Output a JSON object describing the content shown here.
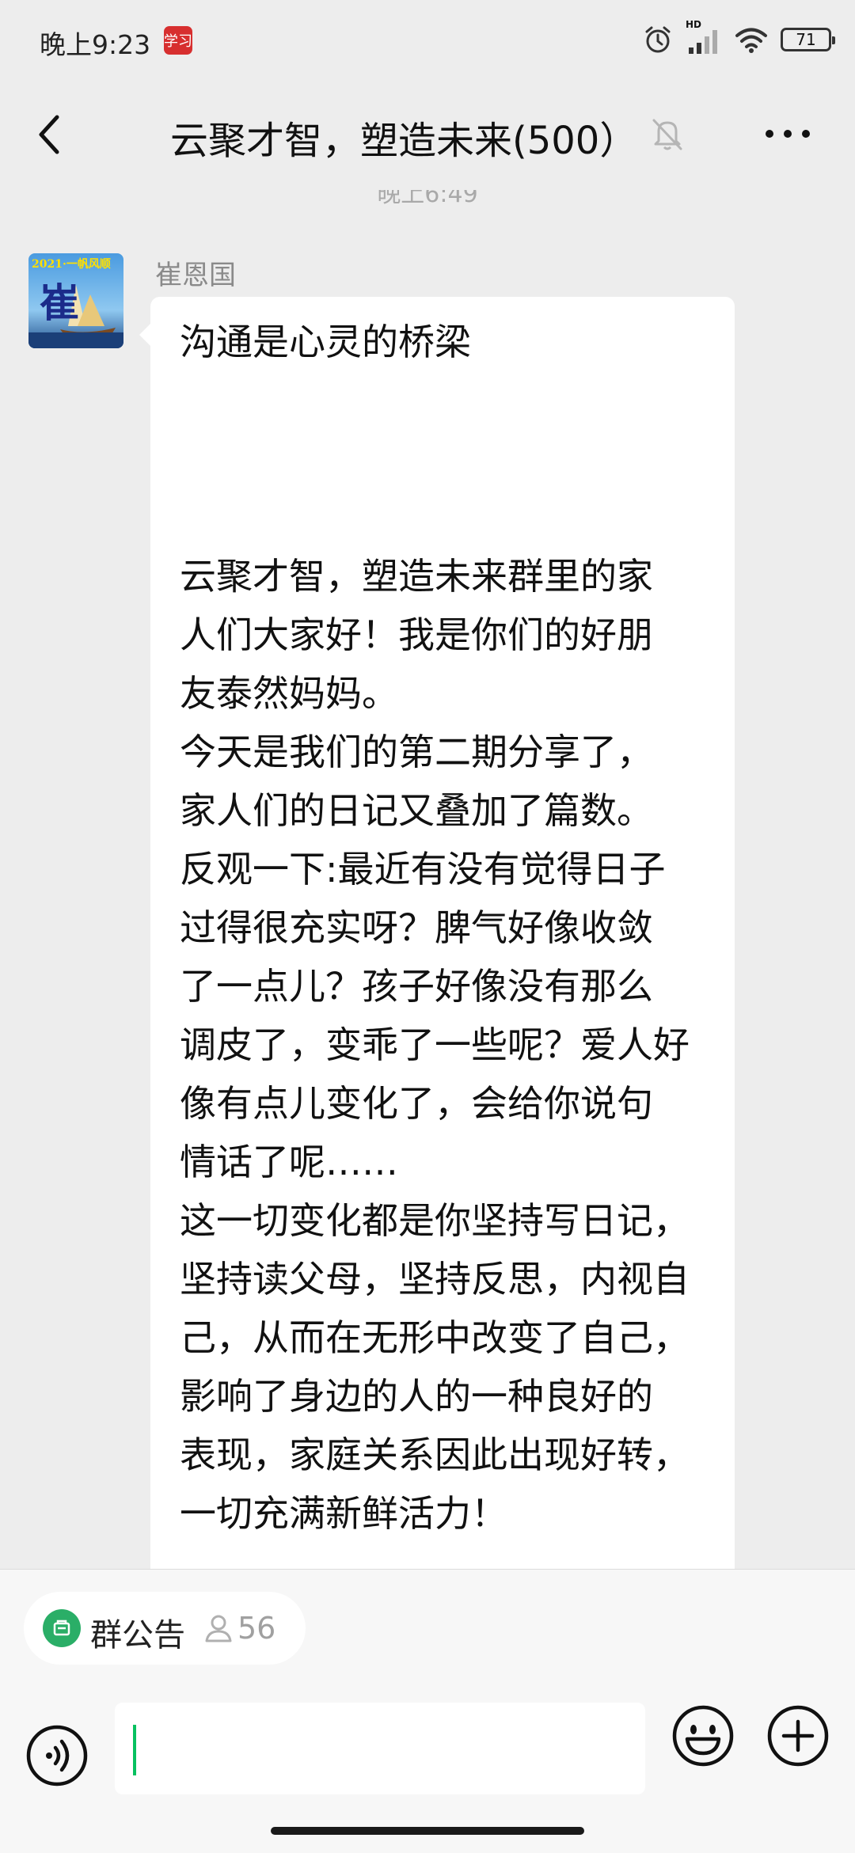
{
  "status_bar": {
    "time": "晚上9:23",
    "app_badge": "学习",
    "hd": "HD",
    "battery": "71"
  },
  "header": {
    "title": "云聚才智，塑造未来(500）"
  },
  "chat": {
    "timestamp": "晚上6:49",
    "sender": "崔恩国",
    "avatar": {
      "banner": "2021·一帆风顺",
      "big_char": "崔"
    },
    "message": {
      "first_line": "沟通是心灵的桥梁",
      "lines": [
        "云聚才智，塑造未来群里的家",
        "人们大家好！我是你们的好朋",
        "友泰然妈妈。",
        "今天是我们的第二期分享了，",
        "家人们的日记又叠加了篇数。",
        "反观一下:最近有没有觉得日子",
        "过得很充实呀？脾气好像收敛",
        "了一点儿？孩子好像没有那么",
        "调皮了，变乖了一些呢？爱人好",
        "像有点儿变化了，会给你说句",
        "情话了呢……",
        "这一切变化都是你坚持写日记，",
        "坚持读父母，坚持反思，内视自",
        "己，从而在无形中改变了自己，",
        "影响了身边的人的一种良好的",
        "表现，家庭关系因此出现好转，",
        "一切充满新鲜活力！"
      ]
    }
  },
  "notice": {
    "label": "群公告",
    "count": "56"
  },
  "input": {
    "value": ""
  },
  "colors": {
    "accent": "#07c160",
    "notice_green": "#2aae67",
    "background": "#ededed"
  },
  "icons": [
    "back-arrow-icon",
    "mute-bell-icon",
    "more-icon",
    "voice-icon",
    "emoji-icon",
    "plus-icon",
    "alarm-icon",
    "signal-icon",
    "wifi-icon"
  ]
}
